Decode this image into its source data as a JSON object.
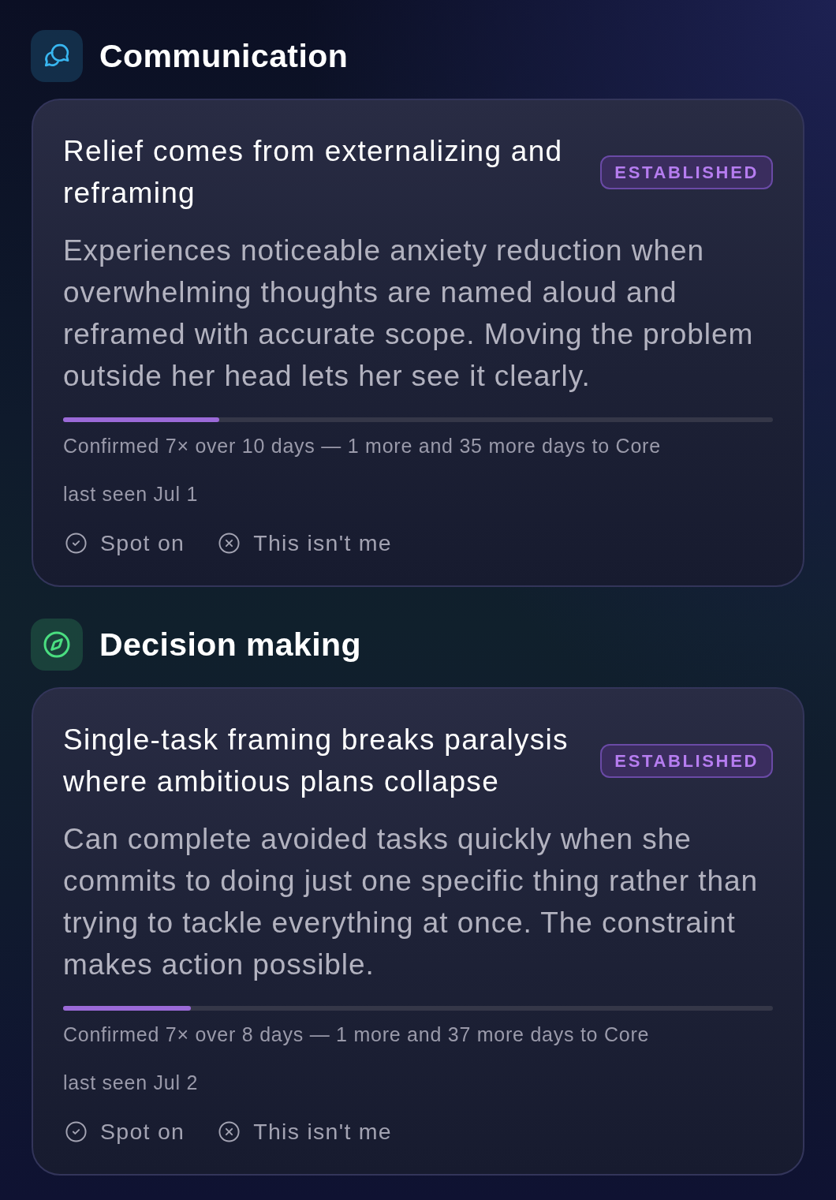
{
  "sections": [
    {
      "title": "Communication",
      "kind": "chat",
      "color": "#38b6f0",
      "card": {
        "title": "Relief comes from externalizing and reframing",
        "status": "ESTABLISHED",
        "description": "Experiences noticeable anxiety reduction when overwhelming thoughts are named aloud and reframed with accurate scope. Moving the problem outside her head lets her see it clearly.",
        "level": 0.22,
        "confirmation": "Confirmed 7× over 10 days — 1 more and 35 more days to Core",
        "last_seen": "last seen Jul 1",
        "actions": [
          {
            "kind": "confirm",
            "label": "Spot on"
          },
          {
            "kind": "reject",
            "label": "This isn't me"
          }
        ]
      }
    },
    {
      "title": "Decision making",
      "kind": "compass",
      "color": "#4ade80",
      "card": {
        "title": "Single-task framing breaks paralysis where ambitious plans collapse",
        "status": "ESTABLISHED",
        "description": "Can complete avoided tasks quickly when she commits to doing just one specific thing rather than trying to tackle everything at once. The constraint makes action possible.",
        "level": 0.18,
        "confirmation": "Confirmed 7× over 8 days — 1 more and 37 more days to Core",
        "last_seen": "last seen Jul 2",
        "actions": [
          {
            "kind": "confirm",
            "label": "Spot on"
          },
          {
            "kind": "reject",
            "label": "This isn't me"
          }
        ]
      }
    }
  ]
}
